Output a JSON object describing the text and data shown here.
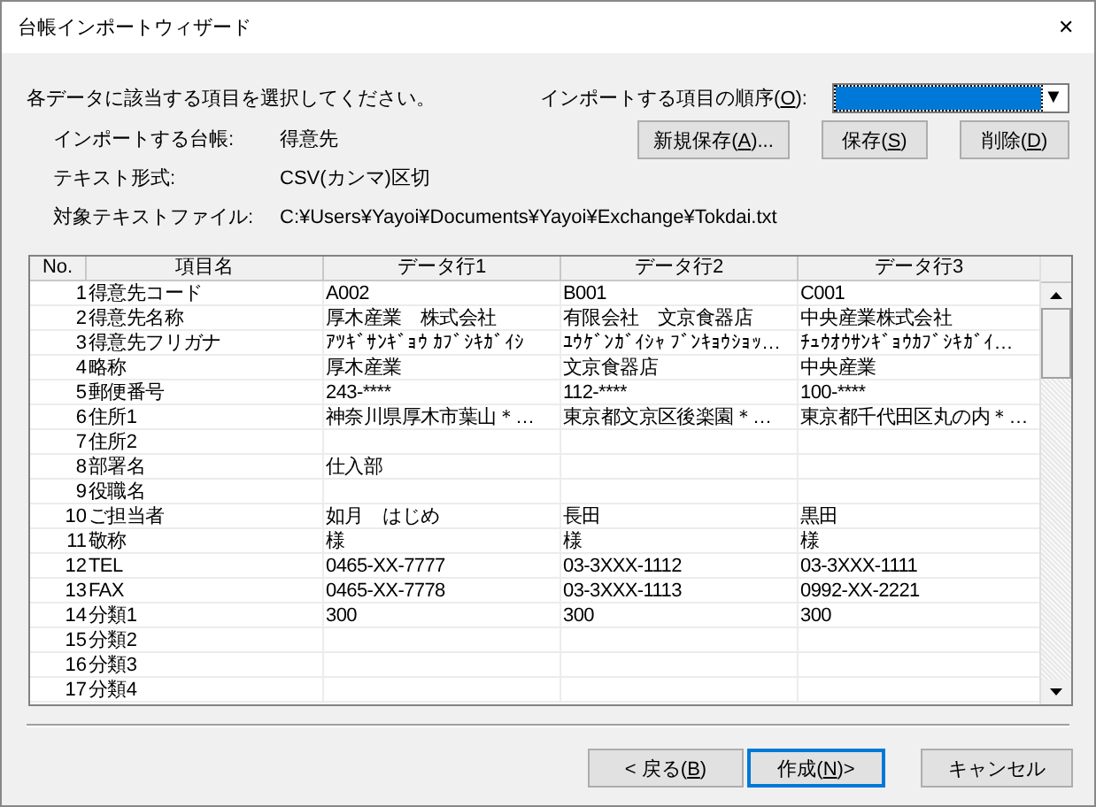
{
  "window": {
    "title": "台帳インポートウィザード",
    "close": "✕"
  },
  "instruction": "各データに該当する項目を選択してください。",
  "order": {
    "label": {
      "before": "インポートする項目の順序(",
      "key": "O",
      "after": "):"
    },
    "dropdown": {
      "arrow": "▼"
    }
  },
  "info": [
    {
      "label": "インポートする台帳:",
      "value": "得意先"
    },
    {
      "label": "テキスト形式:",
      "value": "CSV(カンマ)区切"
    },
    {
      "label": "対象テキストファイル:",
      "value": "C:¥Users¥Yayoi¥Documents¥Yayoi¥Exchange¥Tokdai.txt"
    }
  ],
  "order_buttons": [
    {
      "before": "新規保存(",
      "key": "A",
      "after": ")..."
    },
    {
      "before": "保存(",
      "key": "S",
      "after": ")"
    },
    {
      "before": "削除(",
      "key": "D",
      "after": ")"
    }
  ],
  "table": {
    "columns": [
      "No.",
      "項目名",
      "データ行1",
      "データ行2",
      "データ行3"
    ],
    "rows": [
      {
        "no": "1",
        "name": "得意先コード",
        "cells": [
          "A002",
          "B001",
          "C001"
        ]
      },
      {
        "no": "2",
        "name": "得意先名称",
        "cells": [
          "厚木産業　株式会社",
          "有限会社　文京食器店",
          "中央産業株式会社"
        ]
      },
      {
        "no": "3",
        "name": "得意先フリガナ",
        "cells": [
          "ｱﾂｷﾞｻﾝｷﾞｮｳ ｶﾌﾞｼｷｶﾞｲｼ",
          "ﾕｳｹﾞﾝｶﾞｲｼｬ ﾌﾞﾝｷｮｳｼｮｯ…",
          "ﾁｭｳｵｳｻﾝｷﾞｮｳｶﾌﾞｼｷｶﾞｲ…"
        ]
      },
      {
        "no": "4",
        "name": "略称",
        "cells": [
          "厚木産業",
          "文京食器店",
          "中央産業"
        ]
      },
      {
        "no": "5",
        "name": "郵便番号",
        "cells": [
          "243-****",
          "112-****",
          "100-****"
        ]
      },
      {
        "no": "6",
        "name": "住所1",
        "cells": [
          "神奈川県厚木市葉山＊…",
          "東京都文京区後楽園＊…",
          "東京都千代田区丸の内＊…"
        ]
      },
      {
        "no": "7",
        "name": "住所2",
        "cells": [
          null,
          null,
          null
        ]
      },
      {
        "no": "8",
        "name": "部署名",
        "cells": [
          "仕入部",
          null,
          null
        ]
      },
      {
        "no": "9",
        "name": "役職名",
        "cells": [
          null,
          null,
          null
        ]
      },
      {
        "no": "10",
        "name": "ご担当者",
        "cells": [
          "如月　はじめ",
          "長田",
          "黒田"
        ]
      },
      {
        "no": "11",
        "name": "敬称",
        "cells": [
          "様",
          "様",
          "様"
        ]
      },
      {
        "no": "12",
        "name": "TEL",
        "cells": [
          "0465-XX-7777",
          "03-3XXX-1112",
          "03-3XXX-1111"
        ]
      },
      {
        "no": "13",
        "name": "FAX",
        "cells": [
          "0465-XX-7778",
          "03-3XXX-1113",
          "0992-XX-2221"
        ]
      },
      {
        "no": "14",
        "name": "分類1",
        "cells": [
          "300",
          "300",
          "300"
        ]
      },
      {
        "no": "15",
        "name": "分類2",
        "cells": [
          null,
          null,
          null
        ]
      },
      {
        "no": "16",
        "name": "分類3",
        "cells": [
          null,
          null,
          null
        ]
      },
      {
        "no": "17",
        "name": "分類4",
        "cells": [
          null,
          null,
          null
        ]
      }
    ]
  },
  "footer_buttons": [
    {
      "before": "< 戻る(",
      "key": "B",
      "after": ")",
      "default": false
    },
    {
      "before": "作成(",
      "key": "N",
      "after": ")>",
      "default": true
    },
    {
      "before": "キャンセル",
      "default": false
    }
  ]
}
